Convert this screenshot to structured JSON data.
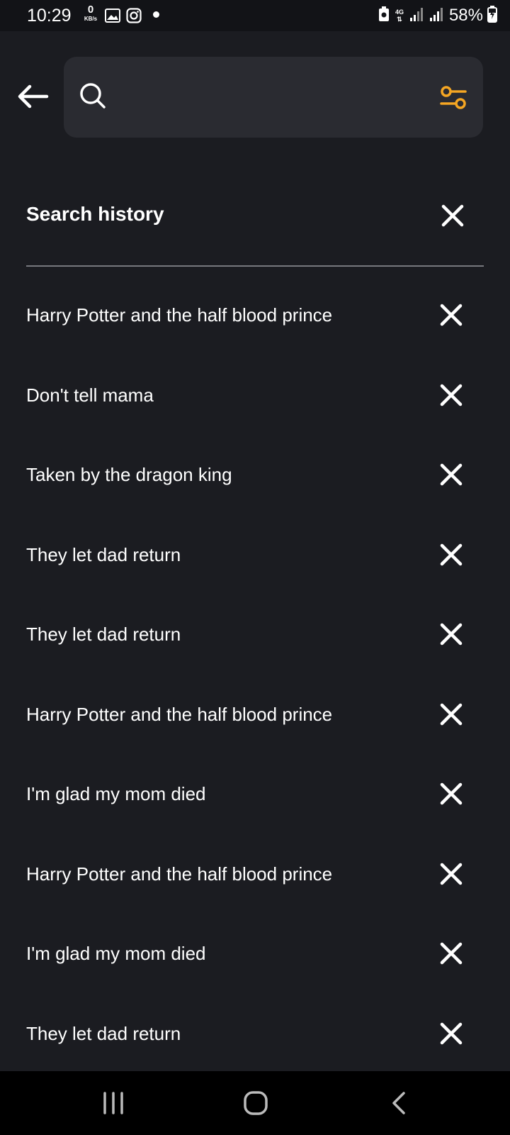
{
  "status_bar": {
    "time": "10:29",
    "net_speed_value": "0",
    "net_speed_unit": "KB/s",
    "network_type": "4G",
    "battery": "58%"
  },
  "search": {
    "placeholder": "",
    "value": ""
  },
  "history": {
    "title": "Search history",
    "items": [
      "Harry Potter and the half blood prince",
      "Don't tell mama",
      "Taken by the dragon king",
      "They let dad return",
      "They let dad return",
      "Harry Potter and the half blood prince",
      "I'm glad my mom died",
      "Harry Potter and the half blood prince",
      "I'm glad my mom died",
      "They let dad return"
    ]
  },
  "colors": {
    "background": "#1b1c21",
    "search_box": "#2a2b31",
    "accent_filter": "#f5a623",
    "text": "#ffffff"
  }
}
